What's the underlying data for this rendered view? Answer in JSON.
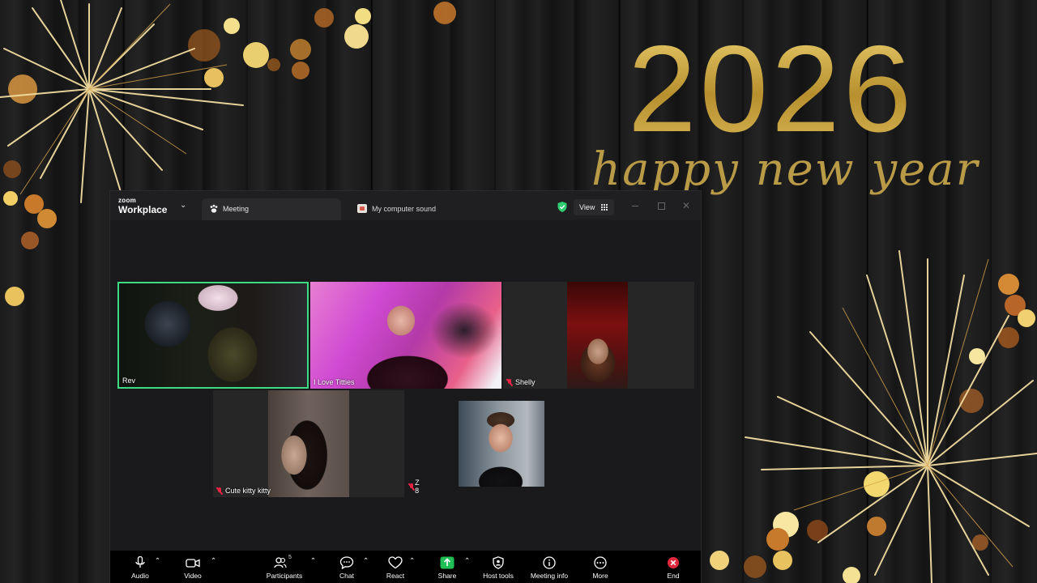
{
  "background": {
    "year": "2026",
    "greeting": "happy new year",
    "gold": "#c9a544"
  },
  "window": {
    "brand_small": "zoom",
    "brand_name": "Workplace",
    "tab_meeting": "Meeting",
    "tab_audio_share": "My computer sound",
    "view_label": "View",
    "security_color": "#2ecc71"
  },
  "participants": [
    {
      "name": "Rev",
      "muted": false,
      "active_speaker": true
    },
    {
      "name": "I Love Titties",
      "muted": false,
      "active_speaker": false
    },
    {
      "name": "Shelly",
      "muted": true,
      "active_speaker": false
    },
    {
      "name": "Cute kitty kitty",
      "muted": true,
      "active_speaker": false
    },
    {
      "name": "Z 8",
      "muted": true,
      "active_speaker": false
    },
    {
      "name": "",
      "muted": false,
      "active_speaker": false
    }
  ],
  "toolbar": {
    "audio": "Audio",
    "video": "Video",
    "participants": "Participants",
    "participants_count": "5",
    "chat": "Chat",
    "react": "React",
    "share": "Share",
    "host_tools": "Host tools",
    "meeting_info": "Meeting info",
    "more": "More",
    "end": "End",
    "share_color": "#1fbf55",
    "end_color": "#e0283c",
    "speaker_highlight": "#3ddc84"
  }
}
